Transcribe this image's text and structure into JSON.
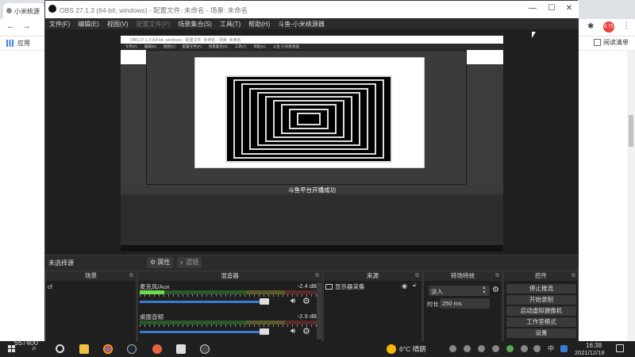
{
  "chrome": {
    "tab_title": "小米桃源",
    "apps_label": "应用",
    "reading_list": "阅读清单",
    "avatar_text": "6.75"
  },
  "obs": {
    "title": "OBS 27.1.3 (64-bit, windows) - 配置文件: 未命名 - 场景: 未命名",
    "menu": [
      {
        "label": "文件(F)",
        "dim": false
      },
      {
        "label": "编辑(E)",
        "dim": false
      },
      {
        "label": "视图(V)",
        "dim": false
      },
      {
        "label": "配置文件(P)",
        "dim": true
      },
      {
        "label": "场景集合(S)",
        "dim": false
      },
      {
        "label": "工具(T)",
        "dim": false
      },
      {
        "label": "帮助(H)",
        "dim": false
      },
      {
        "label": "斗鱼-小米桃源器",
        "dim": false
      }
    ],
    "preview": {
      "notification": "斗鱼平台开播成功"
    },
    "source_bar": {
      "no_source": "未选择源",
      "properties": "属性",
      "filters": "滤镜"
    },
    "docks": {
      "scenes": {
        "title": "场景",
        "items": [
          "cf"
        ]
      },
      "mixer": {
        "title": "混音器",
        "channels": [
          {
            "name": "麦克风/Aux",
            "db": "-2.4 dB",
            "level": 0.14,
            "volume": 0.98
          },
          {
            "name": "桌面音频",
            "db": "-2.9 dB",
            "level": 0.0,
            "volume": 0.98
          }
        ]
      },
      "sources": {
        "title": "来源",
        "items": [
          "显示器采集"
        ]
      },
      "transitions": {
        "title": "转场特效",
        "selected": "淡入",
        "duration_label": "时长",
        "duration_value": "250 ms"
      },
      "controls": {
        "title": "控件",
        "buttons": [
          "停止推流",
          "开始录制",
          "启动虚拟摄像机",
          "工作室模式",
          "设置"
        ]
      }
    }
  },
  "taskbar": {
    "overlay_number": "557400",
    "weather_temp": "6°C",
    "weather_text": "晴朗",
    "ime": "中",
    "time": "16:38",
    "date": "2021/12/18"
  },
  "colors": {
    "obs_bg": "#2b2b2b",
    "meter_green": "#6cdd4c",
    "slider_blue": "#3a7bd5",
    "chrome_avatar": "#e8453c"
  }
}
